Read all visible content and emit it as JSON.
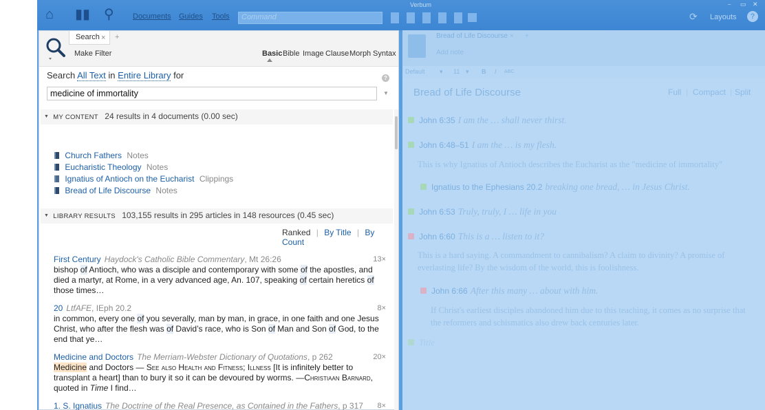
{
  "app": {
    "name": "Verbum",
    "window_controls": [
      "⎯",
      "▭",
      "✕"
    ],
    "toolbar": {
      "menus": [
        "Documents",
        "Guides",
        "Tools"
      ],
      "command_placeholder": "Command",
      "layouts_label": "Layouts",
      "help_label": "?"
    }
  },
  "search_panel": {
    "tab_label": "Search",
    "tab_close": "×",
    "tab_add": "+",
    "make_filter": "Make Filter",
    "modes": [
      "Basic",
      "Bible",
      "Image",
      "Clause",
      "Morph",
      "Syntax"
    ],
    "active_mode": "Basic",
    "search_line": {
      "prefix": "Search",
      "scope": "All Text",
      "in": "in",
      "library": "Entire Library",
      "for": "for"
    },
    "help": "?",
    "query": "medicine of immortality",
    "my_content": {
      "title": "MY CONTENT",
      "summary": "24 results in 4 documents (0.00 sec)",
      "items": [
        {
          "title": "Church Fathers",
          "type": "Notes"
        },
        {
          "title": "Eucharistic Theology",
          "type": "Notes"
        },
        {
          "title": "Ignatius of Antioch on the Eucharist",
          "type": "Clippings"
        },
        {
          "title": "Bread of Life Discourse",
          "type": "Notes"
        }
      ]
    },
    "library_results": {
      "title": "LIBRARY RESULTS",
      "summary": "103,155 results in 295 articles in 148 resources (0.45 sec)",
      "sort": {
        "ranked": "Ranked",
        "by_title": "By Title",
        "by_count": "By Count"
      },
      "results": [
        {
          "title": "First Century",
          "source": "Haydock's Catholic Bible Commentary",
          "location": ", Mt 26:26",
          "count": "13×"
        },
        {
          "title": "20",
          "source": "LtfAFE",
          "location": ", IEph 20.2",
          "count": "8×"
        },
        {
          "title": "Medicine and Doctors",
          "source": "The Merriam-Webster Dictionary of Quotations",
          "location": ", p 262",
          "count": "20×"
        },
        {
          "title": "1. S. Ignatius",
          "source": "The Doctrine of the Real Presence, as Contained in the Fathers",
          "location": ", p 317",
          "count": "8×"
        }
      ]
    }
  },
  "notes_panel": {
    "tab_label": "Bread of Life Discourse",
    "tab_close": "×",
    "tab_add": "+",
    "add_note": "Add note",
    "format": {
      "style": "Default",
      "size": "11",
      "bold": "B",
      "italic": "I",
      "caps": "ABC"
    },
    "title": "Bread of Life Discourse",
    "views": [
      "Full",
      "Compact",
      "Split"
    ],
    "notes": [
      {
        "ref": "John 6:35",
        "quote": "I am the … shall never thirst."
      },
      {
        "ref": "John 6:48–51",
        "quote": "I am the … is my flesh.",
        "body": "This is why Ignatius of Antioch describes the Eucharist as the \"medicine of immortality\""
      },
      {
        "ref": "Ignatius to the Ephesians 20.2",
        "quote": "breaking one bread, … in Jesus Christ."
      },
      {
        "ref": "John 6:53",
        "quote": "Truly, truly, I … life in you"
      },
      {
        "ref": "John 6:60",
        "quote": "This is a … listen to it?",
        "body": "This is a hard saying. A commandment to cannibalism? A claim to divinity? A promise of everlasting life? By the wisdom of the world, this is foolishness."
      },
      {
        "ref": "John 6:66",
        "quote": "After this many … about with him.",
        "body": "If Christ's earliest disciples abandoned him due to this teaching, it comes as no surprise that the reformers and schismatics also drew back centuries later."
      }
    ],
    "placeholder": "Title"
  }
}
